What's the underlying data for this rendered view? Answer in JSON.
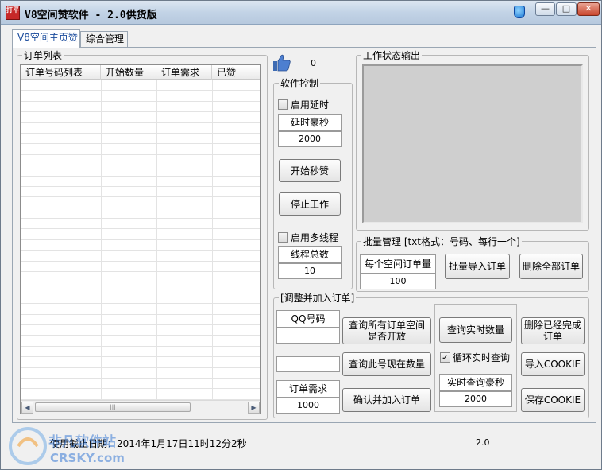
{
  "window": {
    "title_prefix": "V8",
    "title_cn": "空间赞软件",
    "title_suffix": " - 2.0供货版",
    "logo_text": "打平",
    "controls": {
      "minimize": "—",
      "maximize": "□",
      "close": "✕"
    }
  },
  "tabs": [
    {
      "label": "V8空间主页赞",
      "active": true
    },
    {
      "label": "综合管理",
      "active": false
    }
  ],
  "order_list": {
    "group_label": "订单列表",
    "columns": [
      "订单号码列表",
      "开始数量",
      "订单需求",
      "已赞"
    ],
    "rows": []
  },
  "like": {
    "count": "0"
  },
  "software_control": {
    "group_label": "软件控制",
    "delay_checkbox": {
      "label": "启用延时",
      "checked": false
    },
    "delay_label": "延时豪秒",
    "delay_value": "2000",
    "start_button": "开始秒赞",
    "stop_button": "停止工作",
    "multithread_checkbox": {
      "label": "启用多线程",
      "checked": false
    },
    "thread_label": "线程总数",
    "thread_value": "10"
  },
  "work_status": {
    "group_label": "工作状态输出",
    "content": ""
  },
  "batch": {
    "group_label": "批量管理 [txt格式：号码、每行一个]",
    "per_space_label": "每个空间订单量",
    "per_space_value": "100",
    "import_button": "批量导入订单",
    "delete_all_button": "删除全部订单"
  },
  "adjust": {
    "group_label": "[调整并加入订单]",
    "qq_label": "QQ号码",
    "qq_value": "",
    "query_all_button": "查询所有订单空间是否开放",
    "query_now_value": "",
    "query_current_button": "查询此号现在数量",
    "demand_label": "订单需求",
    "demand_value": "1000",
    "confirm_button": "确认并加入订单",
    "realtime_button": "查询实时数量",
    "loop_checkbox": {
      "label": "循环实时查询",
      "checked": true
    },
    "realtime_ms_label": "实时查询豪秒",
    "realtime_ms_value": "2000",
    "delete_done_button": "删除已经完成订单",
    "import_cookie_button": "导入COOKIE",
    "save_cookie_button": "保存COOKIE"
  },
  "status": {
    "expire_text": "使用截止日期：2014年1月17日11时12分2秒",
    "version": "2.0"
  },
  "watermark": {
    "cn": "非凡软件站",
    "en": "CRSKY.com"
  },
  "colors": {
    "title_bar": "#c2d3e6",
    "output_bg": "#cfcfcf",
    "active_tab_text": "#1a4b9c"
  }
}
